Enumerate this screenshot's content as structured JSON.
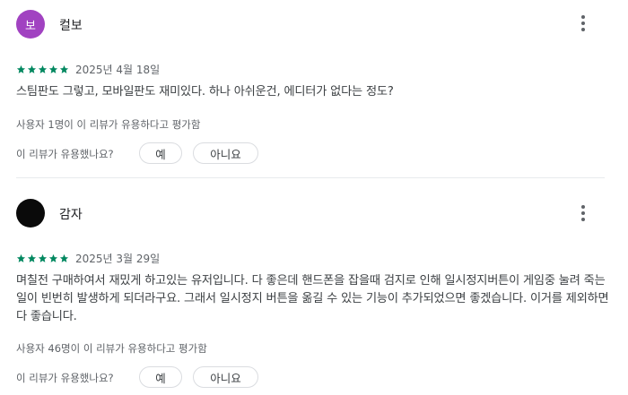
{
  "reviews": [
    {
      "avatar_letter": "보",
      "avatar_color": "#a142c1",
      "author": "컬보",
      "stars": 5,
      "date": "2025년 4월 18일",
      "text": "스팀판도 그렇고, 모바일판도 재미있다. 하나 아쉬운건, 에디터가 없다는 정도?",
      "helpful_count": "사용자 1명이 이 리뷰가 유용하다고 평가함",
      "helpful_question": "이 리뷰가 유용했나요?",
      "yes_label": "예",
      "no_label": "아니요"
    },
    {
      "avatar_letter": "",
      "avatar_color": "#0a0a0a",
      "author": "감자",
      "stars": 5,
      "date": "2025년 3월 29일",
      "text": "며칠전 구매하여서 재밌게 하고있는 유저입니다. 다 좋은데 핸드폰을 잡을때 검지로 인해 일시정지버튼이 게임중 눌려 죽는일이 빈번히 발생하게 되더라구요. 그래서 일시정지 버튼을 옮길 수 있는 기능이 추가되었으면 좋겠습니다. 이거를 제외하면 다 좋습니다.",
      "helpful_count": "사용자 46명이 이 리뷰가 유용하다고 평가함",
      "helpful_question": "이 리뷰가 유용했나요?",
      "yes_label": "예",
      "no_label": "아니요"
    }
  ],
  "colors": {
    "star": "#01875f",
    "divider": "#e8eaed"
  },
  "icons": {
    "more": "more-vert-icon",
    "star": "star-icon"
  }
}
